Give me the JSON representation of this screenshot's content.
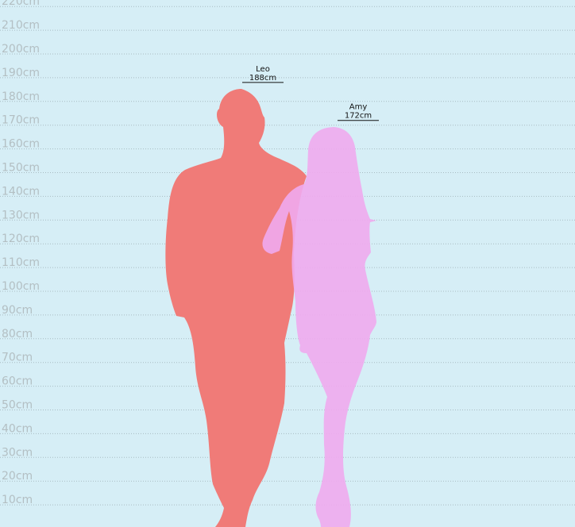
{
  "chart_data": {
    "type": "bar",
    "unit": "cm",
    "ylim": [
      0,
      220
    ],
    "ticks": [
      10,
      20,
      30,
      40,
      50,
      60,
      70,
      80,
      90,
      100,
      110,
      120,
      130,
      140,
      150,
      160,
      170,
      180,
      190,
      200,
      210,
      220
    ],
    "tick_labels": [
      "10cm",
      "20cm",
      "30cm",
      "40cm",
      "50cm",
      "60cm",
      "70cm",
      "80cm",
      "90cm",
      "100cm",
      "110cm",
      "120cm",
      "130cm",
      "140cm",
      "150cm",
      "160cm",
      "170cm",
      "180cm",
      "190cm",
      "200cm",
      "210cm",
      "220cm"
    ],
    "grid": true,
    "categories": [
      "Leo",
      "Amy"
    ],
    "values": [
      188,
      172
    ],
    "value_labels": [
      "188cm",
      "172cm"
    ],
    "colors": [
      "#f07b78",
      "#f0aaee"
    ]
  }
}
